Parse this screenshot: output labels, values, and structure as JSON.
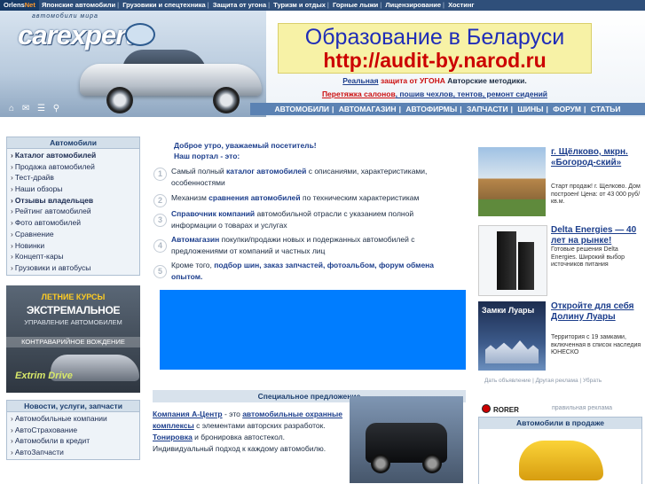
{
  "topnav": {
    "brand_a": "Orlens",
    "brand_b": "Net",
    "items": [
      "Японские автомобили",
      "Грузовики и спецтехника",
      "Защита от угона",
      "Туризм и отдых",
      "Горные лыжи",
      "Лицензирование",
      "Хостинг"
    ]
  },
  "logo": {
    "subtitle": "автомобили мира",
    "name": "carexpert"
  },
  "banner": {
    "line1": "Образование в Беларуси",
    "line2": "http://audit-by.narod.ru"
  },
  "promo": {
    "line1_link": "Реальная",
    "line1_red": "защита от УГОНА",
    "line1_rest": "Авторские методики.",
    "line2_red": "Перетяжка салонов",
    "line2_blue": ", пошив чехлов, тентов, ремонт сидений"
  },
  "mainnav": [
    "АВТОМОБИЛИ",
    "АВТОМАГАЗИН",
    "АВТОФИРМЫ",
    "ЗАПЧАСТИ",
    "ШИНЫ",
    "ФОРУМ",
    "СТАТЬИ"
  ],
  "sidebar": {
    "title": "Автомобили",
    "items": [
      {
        "label": "Каталог автомобилей",
        "bold": true
      },
      {
        "label": "Продажа автомобилей",
        "bold": false
      },
      {
        "label": "Тест-драйв",
        "bold": false
      },
      {
        "label": "Наши обзоры",
        "bold": false
      },
      {
        "label": "Отзывы владельцев",
        "bold": true
      },
      {
        "label": "Рейтинг автомобилей",
        "bold": false
      },
      {
        "label": "Фото автомобилей",
        "bold": false
      },
      {
        "label": "Сравнение",
        "bold": false
      },
      {
        "label": "Новинки",
        "bold": false
      },
      {
        "label": "Концепт-кары",
        "bold": false
      },
      {
        "label": "Грузовики и автобусы",
        "bold": false
      }
    ]
  },
  "side_ad": {
    "line1": "ЛЕТНИЕ КУРСЫ",
    "line2": "ЭКСТРЕМАЛЬНОЕ",
    "line3": "УПРАВЛЕНИЕ АВТОМОБИЛЕМ",
    "line4": "КОНТРАВАРИЙНОЕ ВОЖДЕНИЕ",
    "line5": "Extrim Drive"
  },
  "sidebar2": {
    "title": "Новости, услуги, запчасти",
    "items": [
      "Автомобильные компании",
      "АвтоСтрахование",
      "Автомобили в кредит",
      "АвтоЗапчасти"
    ]
  },
  "center": {
    "greeting": "Доброе утро, уважаемый посетитель!",
    "portal": "Наш портал - это:",
    "features": [
      {
        "num": "1",
        "pre": "Самый полный ",
        "bold": "каталог автомобилей",
        "post": " с описаниями, характеристиками, особенностями"
      },
      {
        "num": "2",
        "pre": "Механизм ",
        "bold": "сравнения автомобилей",
        "post": " по техническим характеристикам"
      },
      {
        "num": "3",
        "pre": "",
        "bold": "Справочник компаний",
        "post": " автомобильной отрасли с указанием полной информации о товарах и услугах"
      },
      {
        "num": "4",
        "pre": "",
        "bold": "Автомагазин",
        "post": " покупки/продажи новых и подержанных автомобилей с предложениями от компаний и частных лиц"
      },
      {
        "num": "5",
        "pre": "Кроме того, ",
        "bold": "подбор шин, заказ запчастей, фотоальбом, форум обмена опытом.",
        "post": ""
      }
    ],
    "special": "Специальное предложение",
    "company_link": "Компания А-Центр",
    "company_text1": " - это ",
    "company_link2": "автомобильные охранные комплексы",
    "company_text2": " с элементами авторских разработок. ",
    "company_link3": "Тонировка",
    "company_text3": " и бронировка автостекол. Индивидуальный подход к каждому автомобилю."
  },
  "right_ads": [
    {
      "title": "г. Щёлково, мкрн. «Богород-ский»",
      "desc": "Старт продаж! г. Щелково. Дом построен! Цена: от 43 000 руб/кв.м."
    },
    {
      "title": "Delta Energies — 40 лет на рынке!",
      "desc": "Готовые решения Delta Energies. Широкий выбор источников питания"
    },
    {
      "title": "Откройте для себя Долину Луары",
      "desc": "Территория с 19 замками, включенная в список наследия ЮНЕСКО",
      "img_label": "Замки Луары"
    }
  ],
  "ad_links": [
    "Дать объявление",
    "Другая реклама",
    "Убрать"
  ],
  "rorer": "RORER",
  "sale_label": "правильная реклама",
  "sale_title": "Автомобили в продаже",
  "colors": {
    "nav": "#5b82b3",
    "topbar": "#2f4f7a",
    "banner_bg": "#f7f2a6",
    "accent_red": "#cc1010",
    "link_blue": "#1c3e8c",
    "promo_blue_box": "#007dff"
  }
}
